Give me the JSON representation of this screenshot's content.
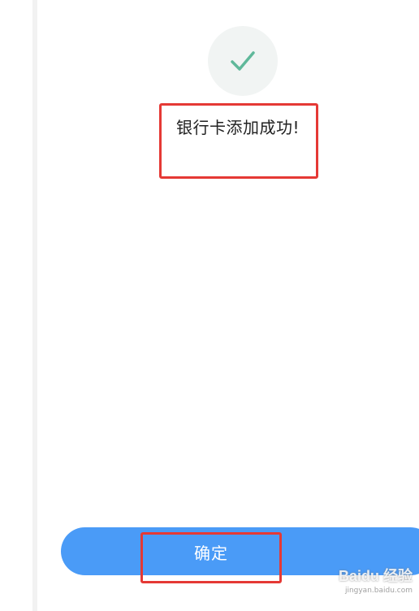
{
  "dialog": {
    "message": "银行卡添加成功!",
    "confirm_label": "确定",
    "icon": "check-icon",
    "check_color": "#5fb89a",
    "button_color": "#4a9bf7",
    "highlight_color": "#e53935"
  },
  "watermark": {
    "brand": "Baidu 经验",
    "url": "jingyan.baidu.com"
  }
}
